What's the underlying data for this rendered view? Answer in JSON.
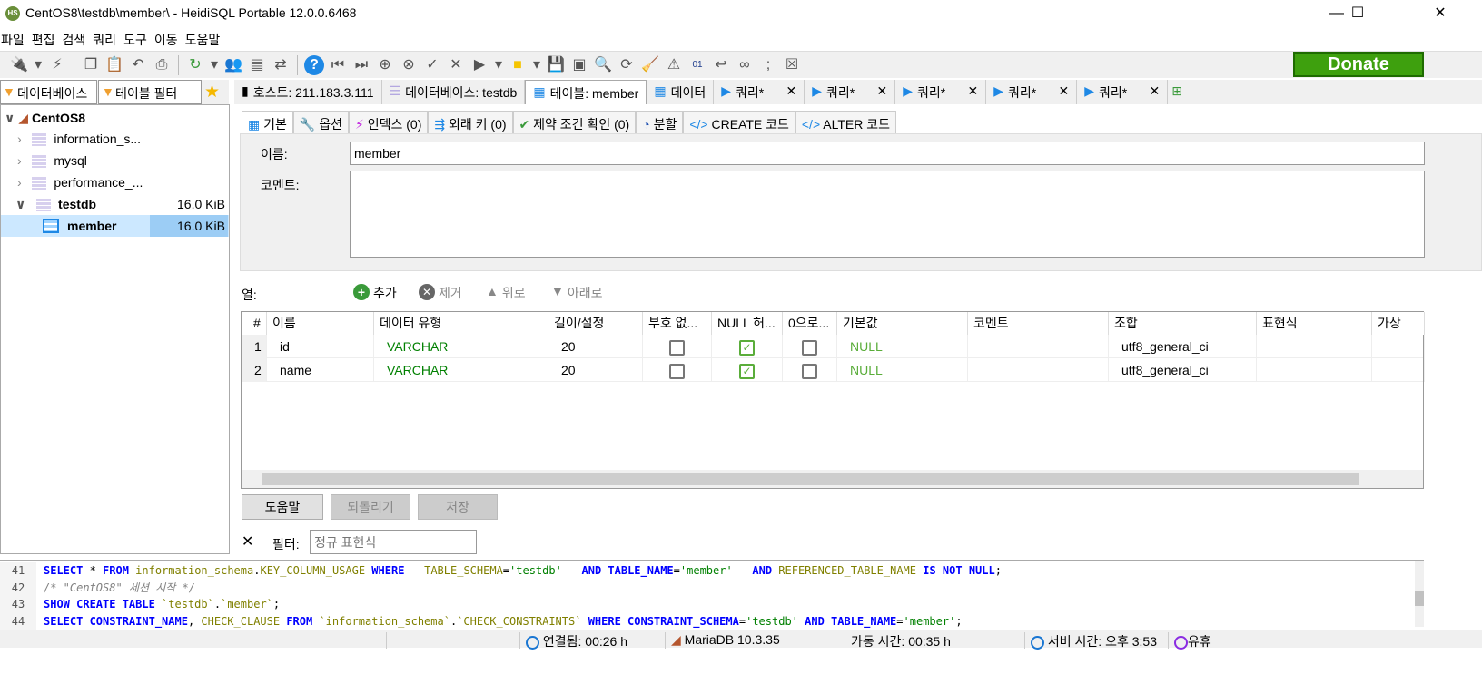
{
  "window": {
    "title": "CentOS8\\testdb\\member\\ - HeidiSQL Portable 12.0.0.6468",
    "logo": "HS"
  },
  "menu": [
    "파일",
    "편집",
    "검색",
    "쿼리",
    "도구",
    "이동",
    "도움말"
  ],
  "toolbar": {
    "donate": "Donate",
    "icons": [
      "connect-icon",
      "dropdown-icon",
      "disconnect-icon",
      "sep",
      "copy-icon",
      "paste-icon",
      "undo-icon",
      "print-icon",
      "sep",
      "refresh-icon",
      "dropdown-icon",
      "users-icon",
      "csv-export-icon",
      "sync-icon",
      "sep",
      "help-icon",
      "first-icon",
      "last-icon",
      "add-icon",
      "remove-icon",
      "check-icon",
      "cancel-icon",
      "run-icon",
      "dropdown-icon",
      "folder-icon",
      "dropdown-icon",
      "save-icon",
      "save-gray-icon",
      "search-icon",
      "replace-icon",
      "clear-icon",
      "warning-icon",
      "binary-icon",
      "wrap-icon",
      "link-icon",
      "semicolon-icon",
      "stop-icon"
    ]
  },
  "left_tabs": {
    "database": "데이터베이스",
    "table_filter": "테이블 필터"
  },
  "tree": {
    "root": "CentOS8",
    "items": [
      {
        "name": "information_s...",
        "size": ""
      },
      {
        "name": "mysql",
        "size": ""
      },
      {
        "name": "performance_...",
        "size": ""
      },
      {
        "name": "testdb",
        "size": "16.0 KiB"
      }
    ],
    "selected": {
      "name": "member",
      "size": "16.0 KiB"
    }
  },
  "main_tabs": [
    {
      "label": "호스트: 211.183.3.111"
    },
    {
      "label": "데이터베이스: testdb"
    },
    {
      "label": "테이블: member"
    },
    {
      "label": "데이터"
    },
    {
      "label": "쿼리*"
    },
    {
      "label": "쿼리*"
    },
    {
      "label": "쿼리*"
    },
    {
      "label": "쿼리*"
    },
    {
      "label": "쿼리*"
    }
  ],
  "sub_tabs": [
    "기본",
    "옵션",
    "인덱스 (0)",
    "외래 키 (0)",
    "제약 조건 확인 (0)",
    "분할",
    "CREATE 코드",
    "ALTER 코드"
  ],
  "form": {
    "name_label": "이름:",
    "name_value": "member",
    "comment_label": "코멘트:",
    "comment_value": ""
  },
  "columns": {
    "label": "열:",
    "add": "추가",
    "remove": "제거",
    "up": "위로",
    "down": "아래로",
    "headers": [
      "#",
      "이름",
      "데이터 유형",
      "길이/설정",
      "부호 없...",
      "NULL 허...",
      "0으로...",
      "기본값",
      "코멘트",
      "조합",
      "표현식",
      "가상"
    ],
    "rows": [
      {
        "num": "1",
        "name": "id",
        "type": "VARCHAR",
        "length": "20",
        "unsigned": false,
        "null": true,
        "zerofill": false,
        "default": "NULL",
        "comment": "",
        "collation": "utf8_general_ci"
      },
      {
        "num": "2",
        "name": "name",
        "type": "VARCHAR",
        "length": "20",
        "unsigned": false,
        "null": true,
        "zerofill": false,
        "default": "NULL",
        "comment": "",
        "collation": "utf8_general_ci"
      }
    ]
  },
  "buttons": {
    "help": "도움말",
    "revert": "되돌리기",
    "save": "저장"
  },
  "filter": {
    "label": "필터:",
    "placeholder": "정규 표현식"
  },
  "sql_log": [
    {
      "num": "41",
      "tokens": [
        [
          "kw",
          "SELECT"
        ],
        [
          "pl",
          " * "
        ],
        [
          "kw",
          "FROM"
        ],
        [
          "id",
          " information_schema"
        ],
        [
          "pl",
          "."
        ],
        [
          "id",
          "KEY_COLUMN_USAGE "
        ],
        [
          "kw",
          "WHERE"
        ],
        [
          "id",
          "   TABLE_SCHEMA"
        ],
        [
          "pl",
          "="
        ],
        [
          "st",
          "'testdb'"
        ],
        [
          "kw",
          "   AND"
        ],
        [
          "kw",
          " TABLE_NAME"
        ],
        [
          "pl",
          "="
        ],
        [
          "st",
          "'member'"
        ],
        [
          "kw",
          "   AND"
        ],
        [
          "id",
          " REFERENCED_TABLE_NAME"
        ],
        [
          "kw",
          " IS NOT NULL"
        ],
        [
          "pl",
          ";"
        ]
      ]
    },
    {
      "num": "42",
      "tokens": [
        [
          "cm",
          "/* \"CentOS8\" 세션 시작 */"
        ]
      ]
    },
    {
      "num": "43",
      "tokens": [
        [
          "kw",
          "SHOW CREATE TABLE"
        ],
        [
          "id",
          " `testdb`"
        ],
        [
          "pl",
          "."
        ],
        [
          "id",
          "`member`"
        ],
        [
          "pl",
          ";"
        ]
      ]
    },
    {
      "num": "44",
      "tokens": [
        [
          "kw",
          "SELECT"
        ],
        [
          "kw",
          " CONSTRAINT_NAME"
        ],
        [
          "pl",
          ", "
        ],
        [
          "id",
          "CHECK_CLAUSE "
        ],
        [
          "kw",
          "FROM"
        ],
        [
          "id",
          " `information_schema`"
        ],
        [
          "pl",
          "."
        ],
        [
          "id",
          "`CHECK_CONSTRAINTS` "
        ],
        [
          "kw",
          "WHERE"
        ],
        [
          "kw",
          " CONSTRAINT_SCHEMA"
        ],
        [
          "pl",
          "="
        ],
        [
          "st",
          "'testdb'"
        ],
        [
          "kw",
          " AND"
        ],
        [
          "kw",
          " TABLE_NAME"
        ],
        [
          "pl",
          "="
        ],
        [
          "st",
          "'member'"
        ],
        [
          "pl",
          ";"
        ]
      ]
    }
  ],
  "status": {
    "connected": "연결됨: 00:26 h",
    "server": "MariaDB 10.3.35",
    "uptime": "가동 시간: 00:35 h",
    "server_time": "서버 시간: 오후 3:53",
    "idle": "유휴"
  }
}
